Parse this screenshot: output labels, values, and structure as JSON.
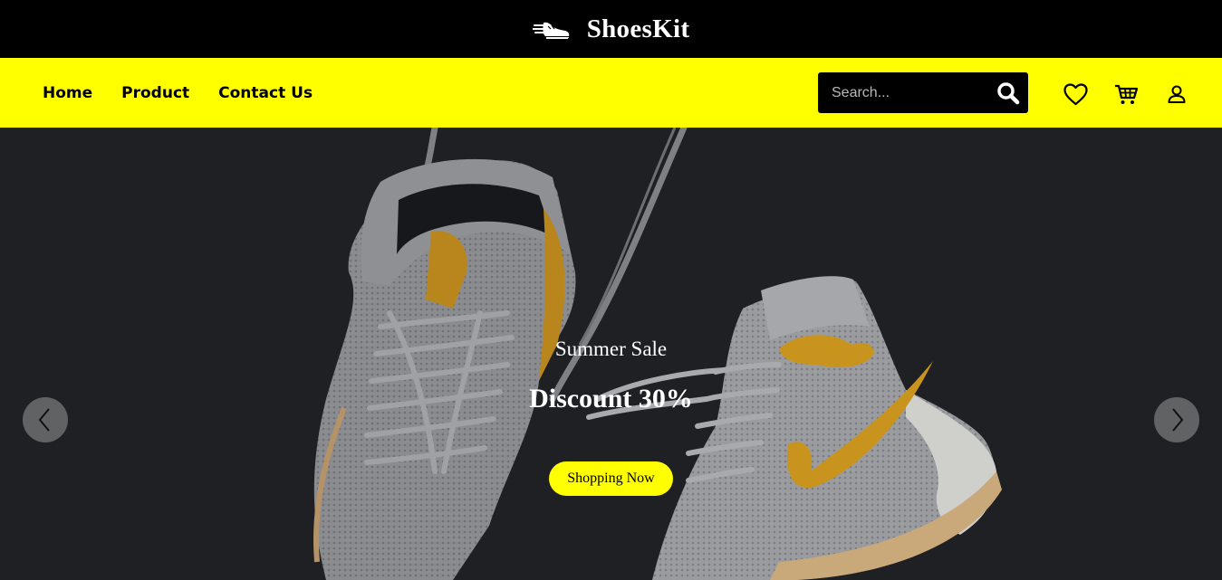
{
  "brand": {
    "name": "ShoesKit",
    "logo_icon": "sneaker-icon"
  },
  "nav": {
    "items": [
      {
        "label": "Home"
      },
      {
        "label": "Product"
      },
      {
        "label": "Contact Us"
      }
    ],
    "search": {
      "placeholder": "Search...",
      "value": "",
      "icon": "search-icon"
    },
    "icons": [
      "heart-icon",
      "cart-icon",
      "user-icon"
    ]
  },
  "hero": {
    "subtitle": "Summer Sale",
    "title": "Discount 30%",
    "cta_label": "Shopping Now",
    "prev_icon": "chevron-left-icon",
    "next_icon": "chevron-right-icon"
  },
  "colors": {
    "topbar": "#000000",
    "accent": "#ffff00",
    "hero_bg": "#1e2024",
    "shoe_primary": "#8d8f92",
    "shoe_accent": "#c9941e"
  }
}
